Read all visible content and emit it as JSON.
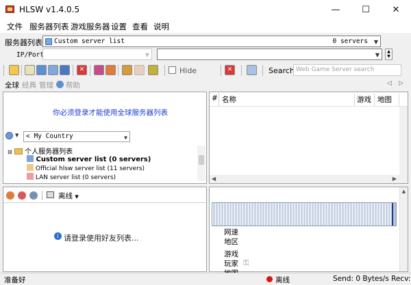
{
  "window": {
    "title": "HLSW v1.4.0.5",
    "buttons": {
      "minimize": "—",
      "maximize": "☐",
      "close": "✕"
    }
  },
  "menu": [
    "文件",
    "服务器列表",
    "游戏服务器",
    "设置",
    "查看",
    "说明"
  ],
  "server_list": {
    "label": "服务器列表",
    "selected": "Custom server list",
    "count": "0 servers"
  },
  "ip_port": {
    "label": "IP/Port",
    "value": ""
  },
  "toolbar": {
    "hide_label": "Hide",
    "search_label": "Search:",
    "search_placeholder": "Web Game Server search"
  },
  "tabs": [
    "全球",
    "经典",
    "管理",
    "帮助"
  ],
  "left_panel": {
    "login_message": "你必须登录才能使用全球服务器列表",
    "country": "My Country",
    "tree": {
      "root": "个人服务器列表",
      "items": [
        "Custom server list (0 servers)",
        "Official hlsw server list (11 servers)",
        "LAN server list (0 servers)"
      ]
    }
  },
  "server_table": {
    "columns": [
      "#",
      "名称",
      "游戏",
      "地图"
    ]
  },
  "friends": {
    "status": "离线",
    "message": "请登录使用好友列表..."
  },
  "details": {
    "labels": [
      "网速",
      "地区",
      "游戏",
      "玩家",
      "地图"
    ]
  },
  "status_bar": {
    "left": "准备好",
    "offline": "离线",
    "send": "Send: 0 Bytes/s Recv:"
  },
  "colors": {
    "accent_red": "#dd1111",
    "login_blue": "#1e3fd6",
    "graph_blue": "#b5c4d8"
  }
}
